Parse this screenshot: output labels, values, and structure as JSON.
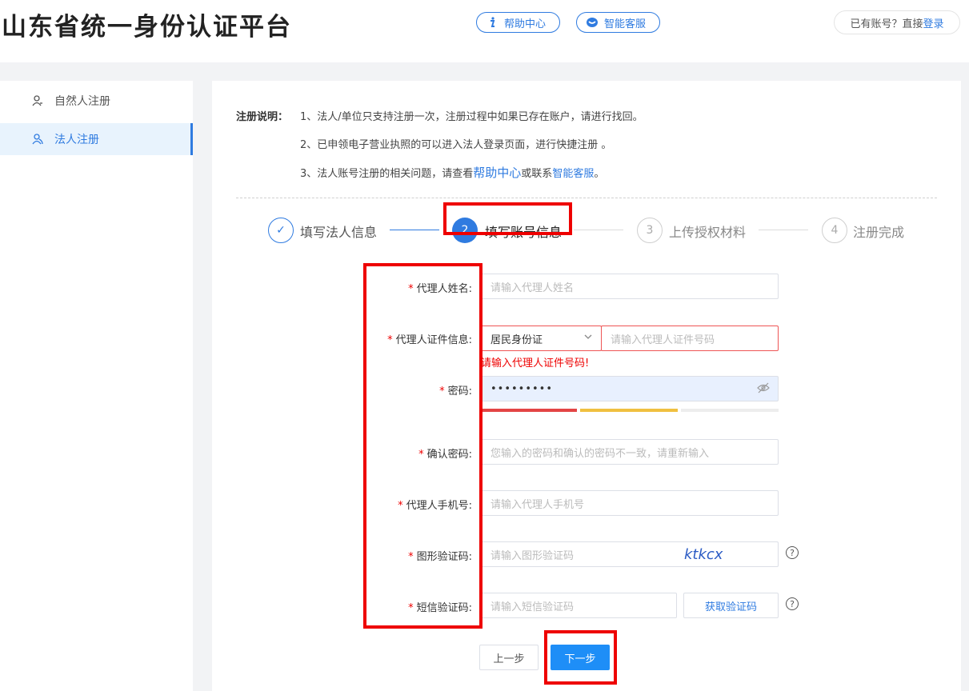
{
  "header": {
    "site_title": "山东省统一身份认证平台",
    "help_label": "帮助中心",
    "service_label": "智能客服",
    "login_prompt": "已有账号？直接",
    "login_link": "登录"
  },
  "sidebar": {
    "items": [
      {
        "label": "自然人注册",
        "icon": "person-icon",
        "active": false
      },
      {
        "label": "法人注册",
        "icon": "people-icon",
        "active": true
      }
    ]
  },
  "notes": {
    "label": "注册说明：",
    "line1": "1、法人/单位只支持注册一次，注册过程中如果已存在账户，请进行找回。",
    "line2": "2、已申领电子营业执照的可以进入法人登录页面，进行快捷注册 。",
    "line3_prefix": "3、法人账号注册的相关问题，请查看",
    "line3_link1": "帮助中心",
    "line3_mid": "或联系",
    "line3_link2": "智能客服",
    "line3_suffix": "。"
  },
  "steps": [
    {
      "num": "✓",
      "label": "填写法人信息",
      "state": "done"
    },
    {
      "num": "2",
      "label": "填写账号信息",
      "state": "active"
    },
    {
      "num": "3",
      "label": "上传授权材料",
      "state": "pending"
    },
    {
      "num": "4",
      "label": "注册完成",
      "state": "pending"
    }
  ],
  "form": {
    "required_mark": "*",
    "agent_name": {
      "label": "代理人姓名:",
      "placeholder": "请输入代理人姓名"
    },
    "agent_id": {
      "label": "代理人证件信息:",
      "select_value": "居民身份证",
      "placeholder": "请输入代理人证件号码",
      "error": "请输入代理人证件号码!"
    },
    "password": {
      "label": "密码:",
      "value": "•••••••••"
    },
    "confirm_password": {
      "label": "确认密码:",
      "placeholder": "您输入的密码和确认的密码不一致，请重新输入"
    },
    "agent_phone": {
      "label": "代理人手机号:",
      "placeholder": "请输入代理人手机号"
    },
    "captcha": {
      "label": "图形验证码:",
      "placeholder": "请输入图形验证码",
      "image_text": "ktkcx"
    },
    "sms": {
      "label": "短信验证码:",
      "placeholder": "请输入短信验证码",
      "button": "获取验证码"
    }
  },
  "buttons": {
    "prev": "上一步",
    "next": "下一步"
  },
  "colors": {
    "accent": "#2f7be0",
    "primary_button": "#1e8ef7",
    "error": "#e00000",
    "highlight_box": "#e00000"
  }
}
